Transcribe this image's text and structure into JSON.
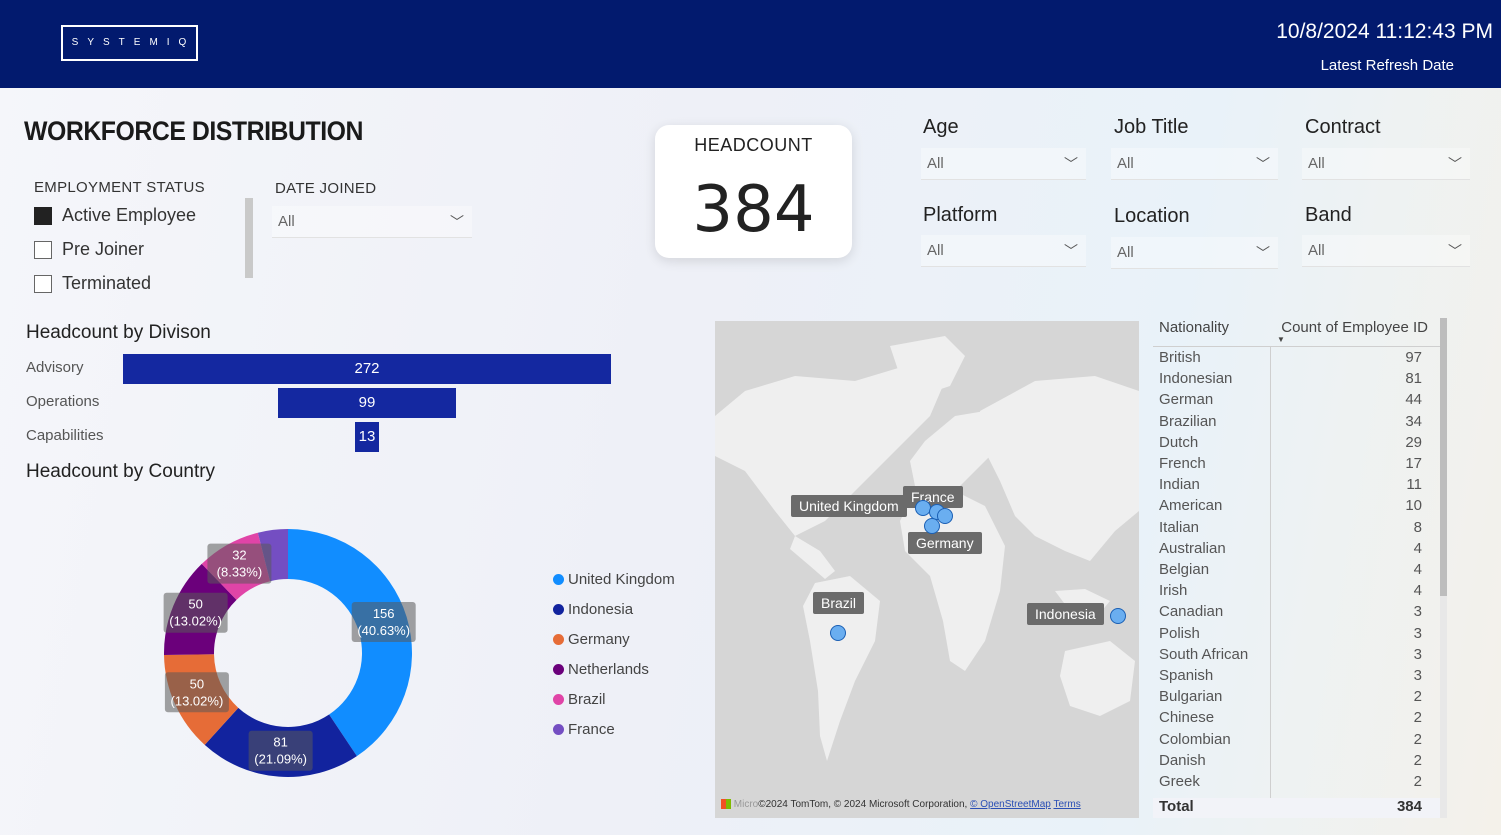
{
  "header": {
    "logo_text": "SYSTEMIQ",
    "refresh_datetime": "10/8/2024 11:12:43 PM",
    "refresh_label": "Latest Refresh Date",
    "bg_color": "#021a6e"
  },
  "page": {
    "title": "WORKFORCE DISTRIBUTION"
  },
  "employment_status": {
    "title": "EMPLOYMENT STATUS",
    "options": [
      {
        "label": "Active Employee",
        "checked": true
      },
      {
        "label": "Pre Joiner",
        "checked": false
      },
      {
        "label": "Terminated",
        "checked": false
      }
    ]
  },
  "date_joined": {
    "title": "DATE JOINED",
    "value": "All"
  },
  "kpi": {
    "label": "HEADCOUNT",
    "value": "384"
  },
  "filters": {
    "age": {
      "label": "Age",
      "value": "All"
    },
    "job_title": {
      "label": "Job Title",
      "value": "All"
    },
    "contract": {
      "label": "Contract",
      "value": "All"
    },
    "platform": {
      "label": "Platform",
      "value": "All"
    },
    "location": {
      "label": "Location",
      "value": "All"
    },
    "band": {
      "label": "Band",
      "value": "All"
    }
  },
  "division_chart": {
    "title": "Headcount by Divison",
    "accent": "#1428a0"
  },
  "country_chart": {
    "title": "Headcount by Country"
  },
  "chart_data": [
    {
      "type": "bar",
      "title": "Headcount by Divison",
      "categories": [
        "Advisory",
        "Operations",
        "Capabilities"
      ],
      "values": [
        272,
        99,
        13
      ]
    },
    {
      "type": "pie",
      "title": "Headcount by Country",
      "categories": [
        "United Kingdom",
        "Indonesia",
        "Germany",
        "Netherlands",
        "Brazil",
        "France"
      ],
      "values": [
        156,
        81,
        50,
        50,
        32,
        15
      ],
      "labels": [
        "156\n(40.63%)",
        "81\n(21.09%)",
        "50\n(13.02%)",
        "50\n(13.02%)",
        "32\n(8.33%)",
        ""
      ],
      "colors": [
        "#118dff",
        "#12239e",
        "#e66c37",
        "#6b007b",
        "#e044a7",
        "#744ec2"
      ]
    }
  ],
  "map": {
    "labels": [
      "United Kingdom",
      "France",
      "Germany",
      "Brazil",
      "Indonesia"
    ],
    "attribution": "©2024 TomTom, © 2024 Microsoft Corporation,",
    "osm_link": "© OpenStreetMap",
    "terms_link": "Terms",
    "brand_fragment": "Micro"
  },
  "nationality_table": {
    "col_nationality": "Nationality",
    "col_count": "Count of Employee ID",
    "rows": [
      {
        "name": "British",
        "count": "97"
      },
      {
        "name": "Indonesian",
        "count": "81"
      },
      {
        "name": "German",
        "count": "44"
      },
      {
        "name": "Brazilian",
        "count": "34"
      },
      {
        "name": "Dutch",
        "count": "29"
      },
      {
        "name": "French",
        "count": "17"
      },
      {
        "name": "Indian",
        "count": "11"
      },
      {
        "name": "American",
        "count": "10"
      },
      {
        "name": "Italian",
        "count": "8"
      },
      {
        "name": "Australian",
        "count": "4"
      },
      {
        "name": "Belgian",
        "count": "4"
      },
      {
        "name": "Irish",
        "count": "4"
      },
      {
        "name": "Canadian",
        "count": "3"
      },
      {
        "name": "Polish",
        "count": "3"
      },
      {
        "name": "South African",
        "count": "3"
      },
      {
        "name": "Spanish",
        "count": "3"
      },
      {
        "name": "Bulgarian",
        "count": "2"
      },
      {
        "name": "Chinese",
        "count": "2"
      },
      {
        "name": "Colombian",
        "count": "2"
      },
      {
        "name": "Danish",
        "count": "2"
      },
      {
        "name": "Greek",
        "count": "2"
      }
    ],
    "total_label": "Total",
    "total_value": "384"
  }
}
